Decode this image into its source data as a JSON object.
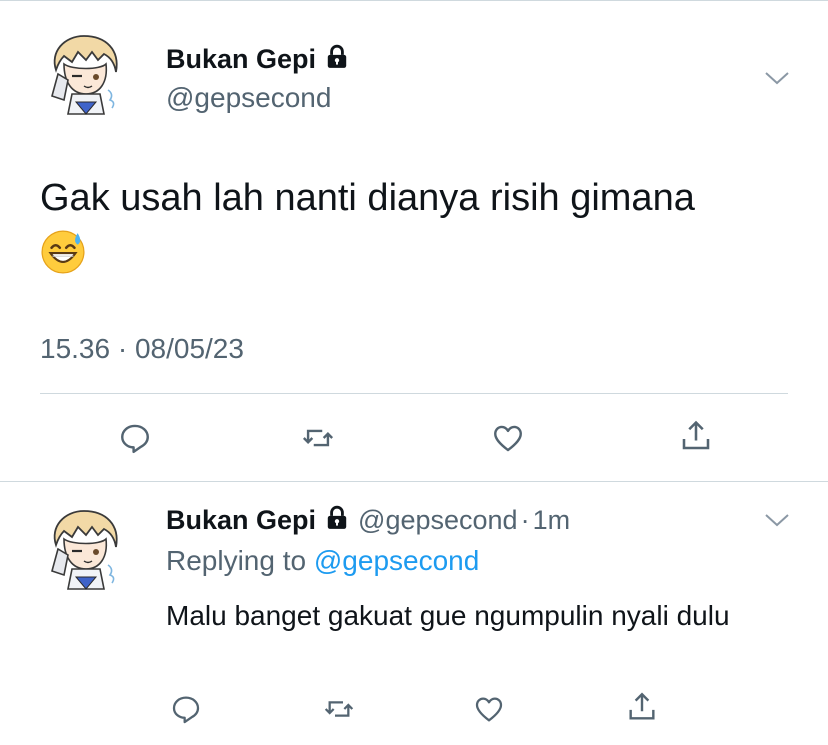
{
  "tweet": {
    "author_name": "Bukan Gepi",
    "handle": "@gepsecond",
    "text": "Gak usah lah nanti dianya risih gimana",
    "emoji": "grinning-face-with-sweat",
    "timestamp": "15.36 · 08/05/23",
    "actions": [
      "reply-icon",
      "retweet-icon",
      "like-icon",
      "share-icon"
    ]
  },
  "reply": {
    "author_name": "Bukan Gepi",
    "handle": "@gepsecond",
    "separator": "·",
    "time": "1m",
    "replying_prefix": "Replying to",
    "replying_to": "@gepsecond",
    "text": "Malu banget gakuat gue ngumpulin nyali dulu",
    "actions": [
      "reply-icon",
      "retweet-icon",
      "like-icon",
      "share-icon"
    ]
  },
  "colors": {
    "text": "#0f1419",
    "secondary": "#536471",
    "link": "#1d9bf0",
    "divider": "#cfd9de"
  }
}
